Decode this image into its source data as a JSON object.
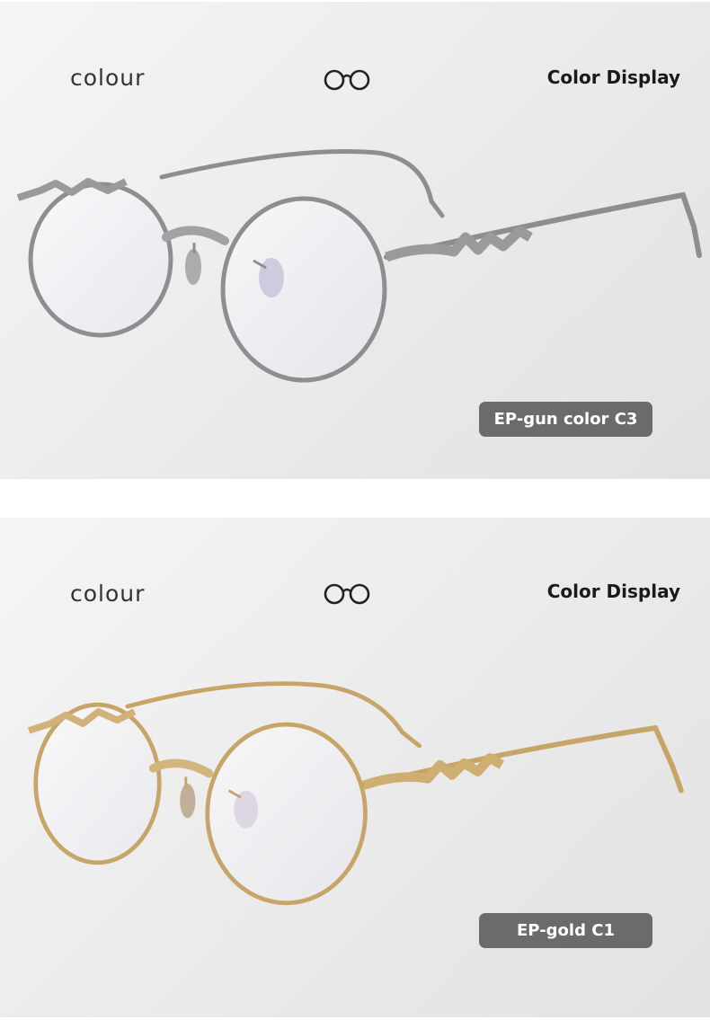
{
  "panels": [
    {
      "left_label": "colour",
      "right_label": "Color Display",
      "badge": "EP-gun color C3",
      "frame_color": "#8e8e90",
      "frame_highlight": "#c9c9cb",
      "icon": "glasses-icon"
    },
    {
      "left_label": "colour",
      "right_label": "Color Display",
      "badge": "EP-gold C1",
      "frame_color": "#c7a468",
      "frame_highlight": "#ead2a2",
      "icon": "glasses-icon"
    }
  ]
}
